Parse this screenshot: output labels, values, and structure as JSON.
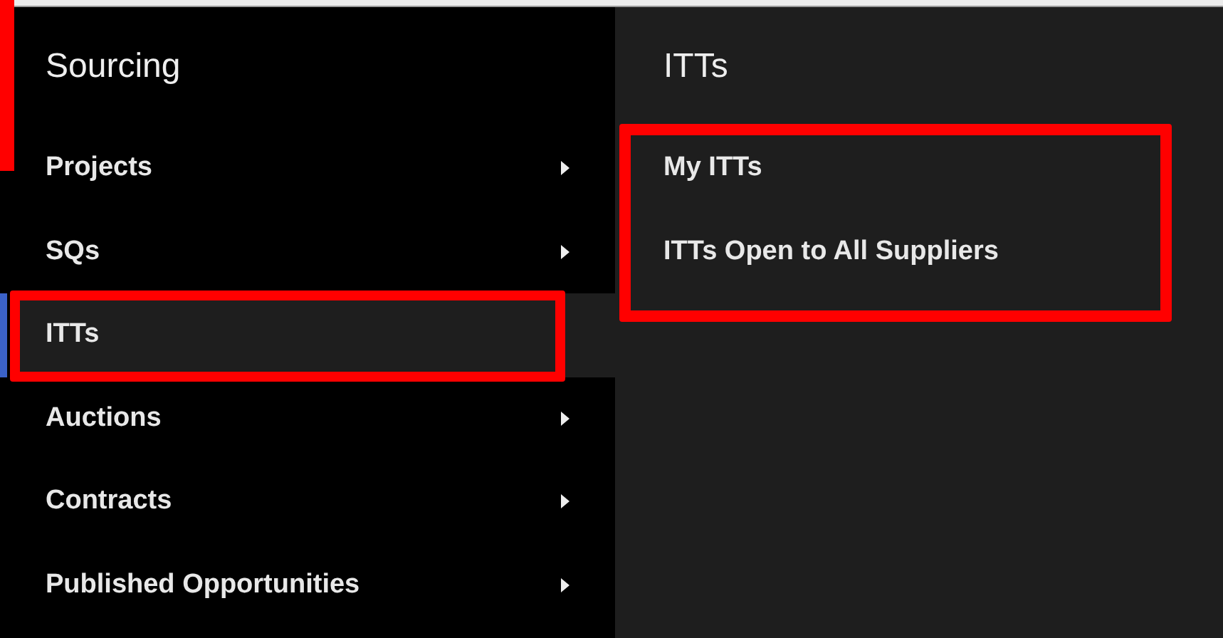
{
  "menu": {
    "title": "Sourcing",
    "items": [
      {
        "label": "Projects",
        "selected": false,
        "has_submenu": true
      },
      {
        "label": "SQs",
        "selected": false,
        "has_submenu": true
      },
      {
        "label": "ITTs",
        "selected": true,
        "has_submenu": false
      },
      {
        "label": "Auctions",
        "selected": false,
        "has_submenu": true
      },
      {
        "label": "Contracts",
        "selected": false,
        "has_submenu": true
      },
      {
        "label": "Published Opportunities",
        "selected": false,
        "has_submenu": true
      }
    ]
  },
  "submenu": {
    "title": "ITTs",
    "items": [
      {
        "label": "My ITTs"
      },
      {
        "label": "ITTs Open to All Suppliers"
      }
    ]
  }
}
